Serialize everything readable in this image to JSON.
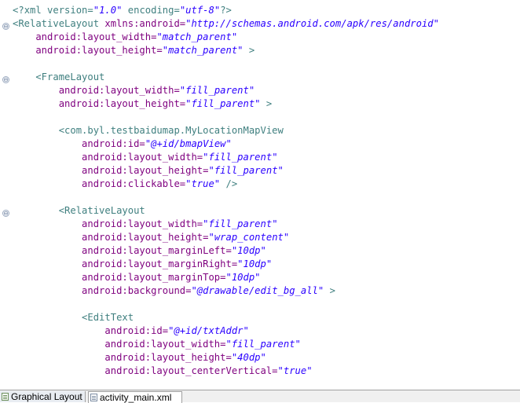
{
  "editor": {
    "lines": {
      "l1": {
        "p1": "<?",
        "p2": "xml version=",
        "p3": "\"1.0\"",
        "p4": " encoding=",
        "p5": "\"utf-8\"",
        "p6": "?>"
      },
      "l2": {
        "p1": "<RelativeLayout",
        "p2": " xmlns:android=",
        "p3": "\"http://schemas.android.com/apk/res/android\""
      },
      "l3": {
        "p1": "    android:layout_width=",
        "p2": "\"match_parent\""
      },
      "l4": {
        "p1": "    android:layout_height=",
        "p2": "\"match_parent\"",
        "p3": " >"
      },
      "l6": {
        "p1": "    <FrameLayout"
      },
      "l7": {
        "p1": "        android:layout_width=",
        "p2": "\"fill_parent\""
      },
      "l8": {
        "p1": "        android:layout_height=",
        "p2": "\"fill_parent\"",
        "p3": " >"
      },
      "l10": {
        "p1": "        <com.byl.testbaidumap.MyLocationMapView"
      },
      "l11": {
        "p1": "            android:id=",
        "p2": "\"@+id/bmapView\""
      },
      "l12": {
        "p1": "            android:layout_width=",
        "p2": "\"fill_parent\""
      },
      "l13": {
        "p1": "            android:layout_height=",
        "p2": "\"fill_parent\""
      },
      "l14": {
        "p1": "            android:clickable=",
        "p2": "\"true\"",
        "p3": " />"
      },
      "l16": {
        "p1": "        <RelativeLayout"
      },
      "l17": {
        "p1": "            android:layout_width=",
        "p2": "\"fill_parent\""
      },
      "l18": {
        "p1": "            android:layout_height=",
        "p2": "\"wrap_content\""
      },
      "l19": {
        "p1": "            android:layout_marginLeft=",
        "p2": "\"10dp\""
      },
      "l20": {
        "p1": "            android:layout_marginRight=",
        "p2": "\"10dp\""
      },
      "l21": {
        "p1": "            android:layout_marginTop=",
        "p2": "\"10dp\""
      },
      "l22": {
        "p1": "            android:background=",
        "p2": "\"@drawable/edit_bg_all\"",
        "p3": " >"
      },
      "l24": {
        "p1": "            <EditText"
      },
      "l25": {
        "p1": "                android:id=",
        "p2": "\"@+id/txtAddr\""
      },
      "l26": {
        "p1": "                android:layout_width=",
        "p2": "\"fill_parent\""
      },
      "l27": {
        "p1": "                android:layout_height=",
        "p2": "\"40dp\""
      },
      "l28": {
        "p1": "                android:layout_centerVertical=",
        "p2": "\"true\""
      }
    }
  },
  "tabs": {
    "graphical_label": "Graphical Layout",
    "source_label": "activity_main.xml"
  },
  "colors": {
    "tag": "#3f7f7f",
    "attribute": "#7f007f",
    "value": "#2a00ff"
  },
  "icons": {
    "fold": "fold-collapse-icon",
    "graphical_tab": "layout-icon",
    "source_tab": "xml-file-icon"
  }
}
